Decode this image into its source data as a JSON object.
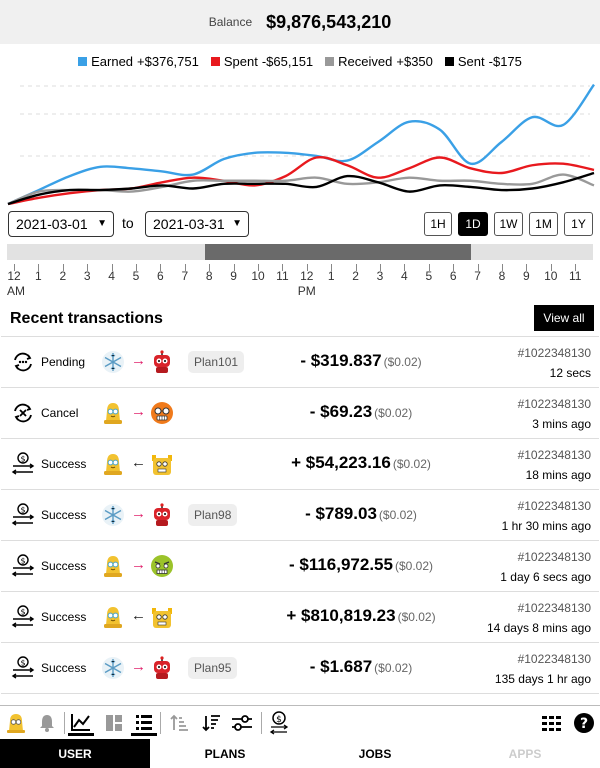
{
  "header": {
    "balance_label": "Balance",
    "balance_value": "$9,876,543,210"
  },
  "chart_data": {
    "type": "line",
    "grid": true,
    "series": [
      {
        "name": "Earned",
        "total": "+$376,751",
        "color": "#3aa0e6",
        "values": [
          0,
          9,
          18,
          24,
          23,
          21,
          19,
          29,
          33,
          33,
          31,
          28,
          40,
          53,
          48,
          26,
          40,
          56,
          51,
          77
        ]
      },
      {
        "name": "Spent",
        "total": "-$65,151",
        "color": "#e8191e",
        "values": [
          0,
          4,
          7,
          9,
          10,
          14,
          17,
          15,
          12,
          18,
          30,
          25,
          17,
          23,
          30,
          23,
          20,
          25,
          26,
          22
        ]
      },
      {
        "name": "Received",
        "total": "+$350",
        "color": "#999999",
        "values": [
          0,
          8,
          9,
          9,
          8,
          11,
          15,
          15,
          15,
          15,
          17,
          13,
          14,
          17,
          15,
          15,
          13,
          13,
          19,
          12
        ]
      },
      {
        "name": "Sent",
        "total": "-$175",
        "color": "#000000",
        "values": [
          0,
          6,
          9,
          9,
          10,
          12,
          10,
          13,
          13,
          13,
          11,
          18,
          14,
          8,
          12,
          11,
          9,
          10,
          14,
          20
        ]
      }
    ]
  },
  "controls": {
    "date_from": "2021-03-01",
    "date_to": "2021-03-31",
    "to_label": "to",
    "ranges": [
      "1H",
      "1D",
      "1W",
      "1M",
      "1Y"
    ],
    "active_range": "1D"
  },
  "timeline": {
    "ticks": [
      "12",
      "1",
      "2",
      "3",
      "4",
      "5",
      "6",
      "7",
      "8",
      "9",
      "10",
      "11",
      "12",
      "1",
      "2",
      "3",
      "4",
      "5",
      "6",
      "7",
      "8",
      "9",
      "10",
      "11"
    ],
    "am_label": "AM",
    "pm_label": "PM"
  },
  "recent": {
    "title": "Recent transactions",
    "view_all": "View all",
    "transactions": [
      {
        "status": "Pending",
        "status_icon": "pending-icon",
        "from": "snowflake",
        "direction": "out",
        "to": "robot-red",
        "plan": "Plan101",
        "amount": "- $319.837",
        "fee": "($0.02)",
        "id": "#1022348130",
        "time": "12 secs"
      },
      {
        "status": "Cancel",
        "status_icon": "cancel-icon",
        "from": "yellow-user",
        "direction": "out",
        "to": "orange-bot",
        "plan": "",
        "amount": "- $69.23",
        "fee": "($0.02)",
        "id": "#1022348130",
        "time": "3 mins ago"
      },
      {
        "status": "Success",
        "status_icon": "success-icon",
        "from": "yellow-user",
        "direction": "in",
        "to": "yellow-bot",
        "plan": "",
        "amount": "+ $54,223.16",
        "fee": "($0.02)",
        "id": "#1022348130",
        "time": "18 mins ago"
      },
      {
        "status": "Success",
        "status_icon": "success-icon",
        "from": "snowflake",
        "direction": "out",
        "to": "robot-red",
        "plan": "Plan98",
        "amount": "- $789.03",
        "fee": "($0.02)",
        "id": "#1022348130",
        "time": "1 hr 30 mins ago"
      },
      {
        "status": "Success",
        "status_icon": "success-icon",
        "from": "yellow-user",
        "direction": "out",
        "to": "green-bot",
        "plan": "",
        "amount": "- $116,972.55",
        "fee": "($0.02)",
        "id": "#1022348130",
        "time": "1 day 6 secs ago"
      },
      {
        "status": "Success",
        "status_icon": "success-icon",
        "from": "yellow-user",
        "direction": "in",
        "to": "yellow-bot",
        "plan": "",
        "amount": "+ $810,819.23",
        "fee": "($0.02)",
        "id": "#1022348130",
        "time": "14 days 8 mins ago"
      },
      {
        "status": "Success",
        "status_icon": "success-icon",
        "from": "snowflake",
        "direction": "out",
        "to": "robot-red",
        "plan": "Plan95",
        "amount": "- $1.687",
        "fee": "($0.02)",
        "id": "#1022348130",
        "time": "135 days 1 hr ago"
      }
    ]
  },
  "toolbar": {
    "icons": [
      "user-avatar-icon",
      "bell-icon",
      "line-chart-icon",
      "dashboard-icon",
      "list-icon",
      "sort-ascending-icon",
      "sort-descending-icon",
      "filter-sliders-icon",
      "transfer-icon",
      "grid-menu-icon",
      "help-icon"
    ]
  },
  "tabs": [
    {
      "label": "USER",
      "state": "active"
    },
    {
      "label": "PLANS",
      "state": "normal"
    },
    {
      "label": "JOBS",
      "state": "normal"
    },
    {
      "label": "APPS",
      "state": "disabled"
    }
  ]
}
